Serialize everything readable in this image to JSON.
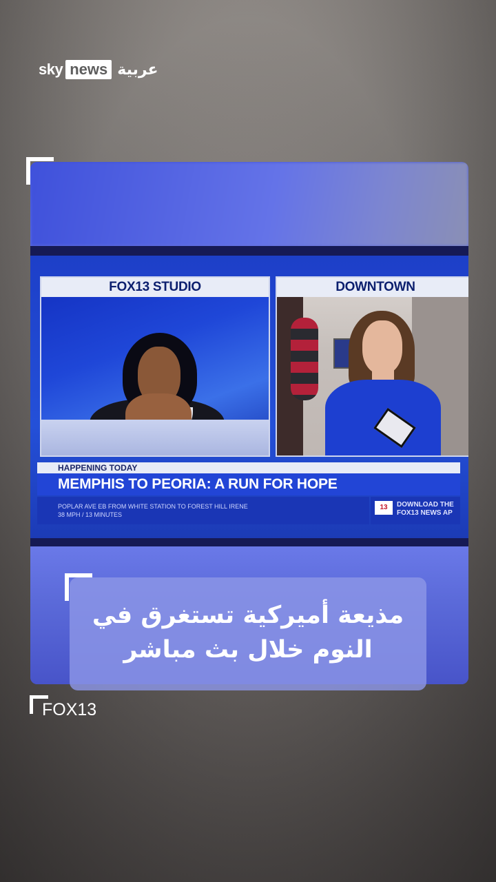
{
  "brand": {
    "sky": "sky",
    "news": "news",
    "arabic": "عربية"
  },
  "video": {
    "panels": {
      "left_label": "FOX13 STUDIO",
      "right_label": "DOWNTOWN"
    },
    "lower_third": {
      "kicker": "HAPPENING TODAY",
      "headline": "MEMPHIS TO PEORIA: A RUN FOR HOPE",
      "ticker_line1": "POPLAR AVE EB FROM WHITE STATION TO FOREST HILL IRENE",
      "ticker_line2": "38 MPH / 13 MINUTES",
      "promo_badge": "13",
      "promo_line1": "DOWNLOAD THE",
      "promo_line2": "FOX13 NEWS AP"
    }
  },
  "caption": {
    "line1": "مذيعة أميركية تستغرق في",
    "line2": "النوم خلال بث مباشر"
  },
  "credit": "FOX13",
  "colors": {
    "accent": "#2245d6",
    "caption_bg": "#8c96e6"
  }
}
